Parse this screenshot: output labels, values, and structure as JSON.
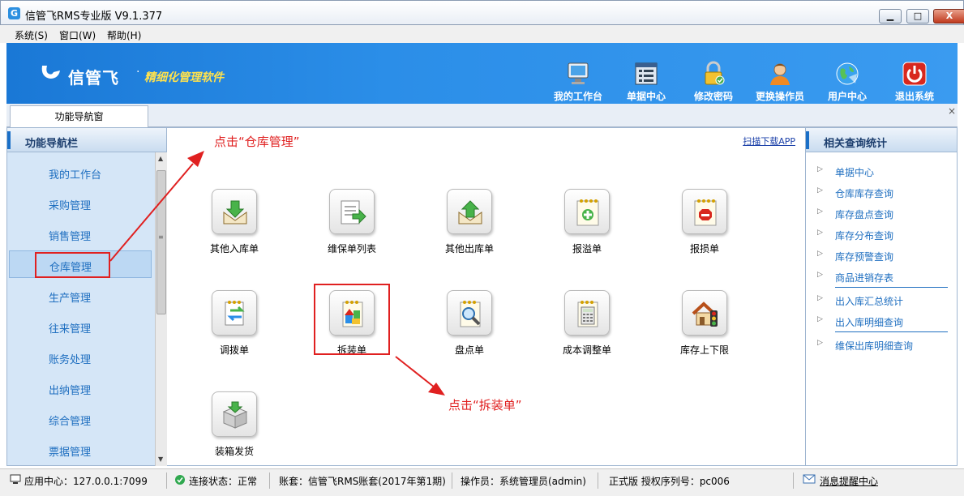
{
  "window": {
    "title": "信管飞RMS专业版 V9.1.377",
    "min_label": "▁",
    "max_label": "□",
    "close_label": "X"
  },
  "menu": {
    "items": [
      "系统(S)",
      "窗口(W)",
      "帮助(H)"
    ]
  },
  "banner": {
    "logo_text": "信管飞",
    "slogan": "精细化管理软件",
    "buttons": [
      {
        "label": "我的工作台",
        "icon": "monitor-icon"
      },
      {
        "label": "单据中心",
        "icon": "document-list-icon"
      },
      {
        "label": "修改密码",
        "icon": "padlock-icon"
      },
      {
        "label": "更换操作员",
        "icon": "user-icon"
      },
      {
        "label": "用户中心",
        "icon": "globe-icon"
      },
      {
        "label": "退出系统",
        "icon": "power-icon"
      }
    ]
  },
  "tabs": {
    "active": "功能导航窗",
    "close": "×"
  },
  "left_nav": {
    "header": "功能导航栏",
    "items": [
      "我的工作台",
      "采购管理",
      "销售管理",
      "仓库管理",
      "生产管理",
      "往来管理",
      "账务处理",
      "出纳管理",
      "综合管理",
      "票据管理"
    ],
    "active_index": 3
  },
  "center": {
    "scan_link": "扫描下载APP",
    "icons": [
      {
        "label": "其他入库单",
        "icon": "inbound-icon"
      },
      {
        "label": "维保单列表",
        "icon": "list-arrow-icon"
      },
      {
        "label": "其他出库单",
        "icon": "outbound-icon"
      },
      {
        "label": "报溢单",
        "icon": "plus-note-icon"
      },
      {
        "label": "报损单",
        "icon": "stop-note-icon"
      },
      {
        "label": "调拨单",
        "icon": "transfer-icon"
      },
      {
        "label": "拆装单",
        "icon": "disassembly-icon"
      },
      {
        "label": "盘点单",
        "icon": "magnifier-icon"
      },
      {
        "label": "成本调整单",
        "icon": "calculator-icon"
      },
      {
        "label": "库存上下限",
        "icon": "house-light-icon"
      },
      {
        "label": "装箱发货",
        "icon": "box-icon"
      }
    ]
  },
  "annotations": {
    "note1": "点击“仓库管理”",
    "note2": "点击“拆装单”"
  },
  "right_panel": {
    "header": "相关查询统计",
    "items": [
      "单据中心",
      "仓库库存查询",
      "库存盘点查询",
      "库存分布查询",
      "库存预警查询",
      "商品进销存表",
      "出入库汇总统计",
      "出入库明细查询",
      "维保出库明细查询"
    ]
  },
  "status": {
    "app_center": "应用中心：127.0.0.1:7099",
    "connection": "连接状态：正常",
    "account": "账套：信管飞RMS账套(2017年第1期)",
    "operator": "操作员：系统管理员(admin)",
    "license": "正式版 授权序列号：pc006",
    "messages": "消息提醒中心"
  },
  "colors": {
    "banner_blue": "#2b8ee8",
    "accent_red": "#e02020",
    "nav_text": "#1f6fc0"
  }
}
